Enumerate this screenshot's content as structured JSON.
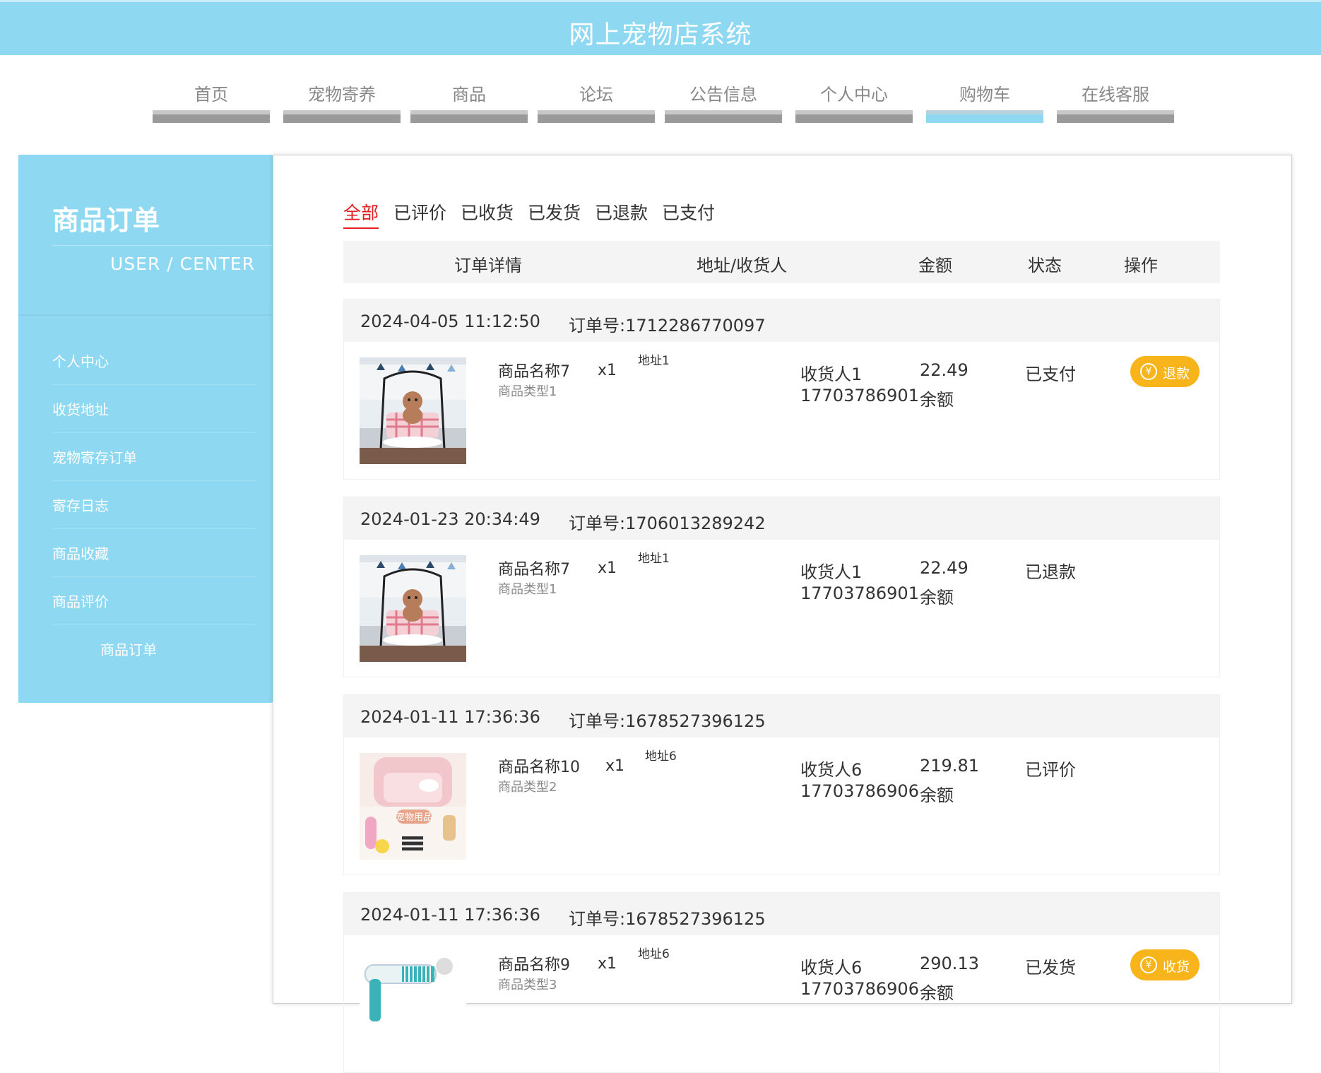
{
  "header": {
    "title": "网上宠物店系统"
  },
  "nav": {
    "items": [
      {
        "label": "首页"
      },
      {
        "label": "宠物寄养"
      },
      {
        "label": "商品"
      },
      {
        "label": "论坛"
      },
      {
        "label": "公告信息"
      },
      {
        "label": "个人中心"
      },
      {
        "label": "购物车"
      },
      {
        "label": "在线客服"
      }
    ],
    "active": "购物车"
  },
  "sidebar": {
    "title": "商品订单",
    "subtitle": "USER / CENTER",
    "items": [
      {
        "label": "个人中心"
      },
      {
        "label": "收货地址"
      },
      {
        "label": "宠物寄存订单"
      },
      {
        "label": "寄存日志"
      },
      {
        "label": "商品收藏"
      },
      {
        "label": "商品评价"
      },
      {
        "label": "商品订单"
      }
    ],
    "active": "商品订单"
  },
  "tabs": [
    {
      "label": "全部"
    },
    {
      "label": "已评价"
    },
    {
      "label": "已收货"
    },
    {
      "label": "已发货"
    },
    {
      "label": "已退款"
    },
    {
      "label": "已支付"
    }
  ],
  "active_tab": "全部",
  "table": {
    "headers": [
      "订单详情",
      "地址/收货人",
      "金额",
      "状态",
      "操作"
    ]
  },
  "orders": [
    {
      "date": "2024-04-05 11:12:50",
      "order_no": "订单号:1712286770097",
      "product_name": "商品名称7",
      "product_type": "商品类型1",
      "qty": "x1",
      "address": "地址1",
      "receiver": "收货人1",
      "phone": "17703786901",
      "amount": "22.49",
      "pay_method": "余额",
      "status": "已支付",
      "action": "退款",
      "image": "dog-swing-image"
    },
    {
      "date": "2024-01-23 20:34:49",
      "order_no": "订单号:1706013289242",
      "product_name": "商品名称7",
      "product_type": "商品类型1",
      "qty": "x1",
      "address": "地址1",
      "receiver": "收货人1",
      "phone": "17703786901",
      "amount": "22.49",
      "pay_method": "余额",
      "status": "已退款",
      "action": "",
      "image": "dog-swing-image"
    },
    {
      "date": "2024-01-11 17:36:36",
      "order_no": "订单号:1678527396125",
      "product_name": "商品名称10",
      "product_type": "商品类型2",
      "qty": "x1",
      "address": "地址6",
      "receiver": "收货人6",
      "phone": "17703786906",
      "amount": "219.81",
      "pay_method": "余额",
      "status": "已评价",
      "action": "",
      "image": "pet-supplies-image",
      "image_text": "宠物用品"
    },
    {
      "date": "2024-01-11 17:36:36",
      "order_no": "订单号:1678527396125",
      "product_name": "商品名称9",
      "product_type": "商品类型3",
      "qty": "x1",
      "address": "地址6",
      "receiver": "收货人6",
      "phone": "17703786906",
      "amount": "290.13",
      "pay_method": "余额",
      "status": "已发货",
      "action": "收货",
      "image": "grooming-tool-image"
    }
  ],
  "colors": {
    "brand": "#8fd8f2",
    "active_tab": "#e02020",
    "action_button": "#f7b51b",
    "nav_bar": "#9a9a9a"
  }
}
